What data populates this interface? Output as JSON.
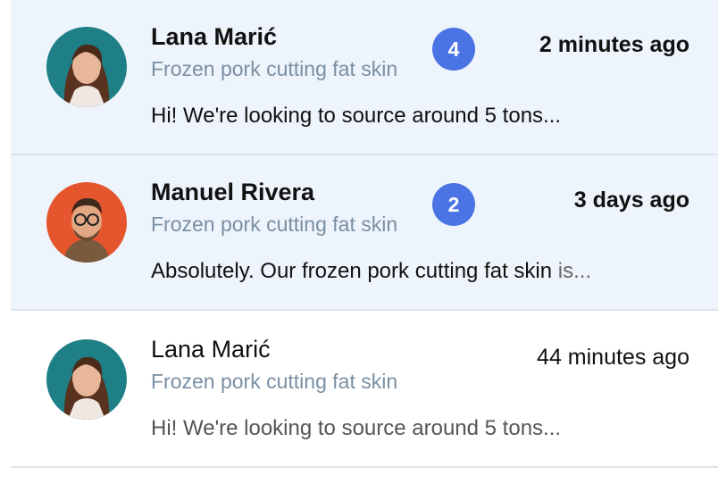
{
  "conversations": [
    {
      "name": "Lana Marić",
      "subject": "Frozen pork cutting fat skin",
      "unread_count": "4",
      "time": "2 minutes ago",
      "preview": "Hi! We're looking to source around 5 tons...",
      "preview_rest": "",
      "avatar": "woman-portrait",
      "avatar_bg": "#1f7f86",
      "state": "unread"
    },
    {
      "name": "Manuel Rivera",
      "subject": "Frozen pork cutting fat skin",
      "unread_count": "2",
      "time": "3 days ago",
      "preview": "Absolutely. Our frozen pork cutting fat skin",
      "preview_rest": " is...",
      "avatar": "man-portrait",
      "avatar_bg": "#e5562e",
      "state": "unread"
    },
    {
      "name": "Lana Marić",
      "subject": "Frozen pork cutting fat skin",
      "unread_count": "",
      "time": "44 minutes ago",
      "preview": "Hi! We're looking to source around 5 tons...",
      "preview_rest": "",
      "avatar": "woman-portrait",
      "avatar_bg": "#1f7f86",
      "state": "read"
    }
  ],
  "colors": {
    "unread_row_bg": "#eef4fb",
    "badge": "#4a73e3",
    "subject_text": "#7a8fa3",
    "divider": "#dde3ea"
  }
}
